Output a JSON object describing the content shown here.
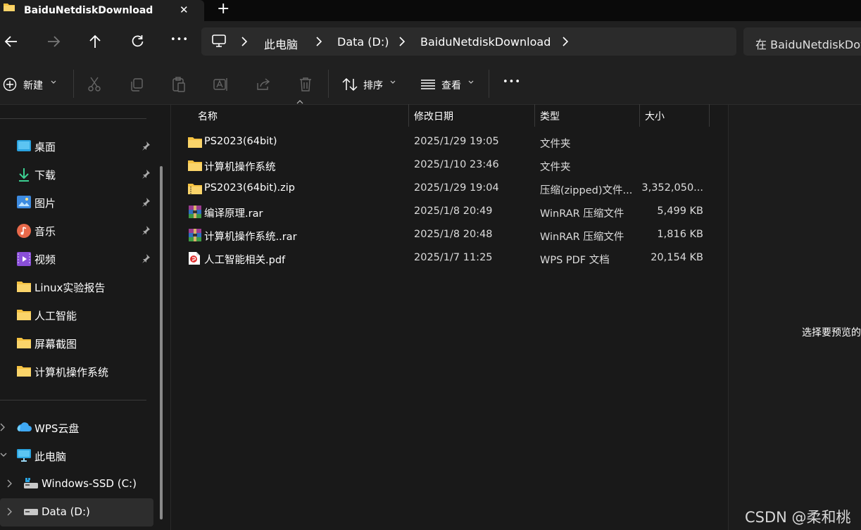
{
  "window": {
    "tab_title": "BaiduNetdiskDownload",
    "close_glyph": "✕",
    "new_tab_glyph": "+"
  },
  "nav": {
    "back_icon": "arrow-left-icon",
    "forward_icon": "arrow-right-icon",
    "up_icon": "arrow-up-icon",
    "refresh_icon": "refresh-icon",
    "more_glyph": "•••"
  },
  "breadcrumb": [
    "此电脑",
    "Data (D:)",
    "BaiduNetdiskDownload"
  ],
  "search": {
    "placeholder": "在 BaiduNetdiskDow"
  },
  "toolbar": {
    "new_label": "新建",
    "sort_label": "排序",
    "view_label": "查看",
    "more_glyph": "•••"
  },
  "sidebar": {
    "quick_access": [
      {
        "label": "桌面",
        "icon": "desktop-icon",
        "pinned": true
      },
      {
        "label": "下载",
        "icon": "download-icon",
        "pinned": true
      },
      {
        "label": "图片",
        "icon": "pictures-icon",
        "pinned": true
      },
      {
        "label": "音乐",
        "icon": "music-icon",
        "pinned": true
      },
      {
        "label": "视频",
        "icon": "video-icon",
        "pinned": true
      },
      {
        "label": "Linux实验报告",
        "icon": "folder-icon",
        "pinned": false
      },
      {
        "label": "人工智能",
        "icon": "folder-icon",
        "pinned": false
      },
      {
        "label": "屏幕截图",
        "icon": "folder-icon",
        "pinned": false
      },
      {
        "label": "计算机操作系统",
        "icon": "folder-icon",
        "pinned": false
      }
    ],
    "locations": [
      {
        "label": "WPS云盘",
        "icon": "cloud-icon",
        "expanded": false
      },
      {
        "label": "此电脑",
        "icon": "pc-icon",
        "expanded": true
      },
      {
        "label": "Windows-SSD (C:)",
        "icon": "drive-icon",
        "expanded": false
      },
      {
        "label": "Data (D:)",
        "icon": "drive-icon",
        "expanded": false,
        "selected": true
      }
    ]
  },
  "list": {
    "columns": [
      "名称",
      "修改日期",
      "类型",
      "大小"
    ],
    "rows": [
      {
        "name": "PS2023(64bit)",
        "date": "2025/1/29 19:05",
        "type": "文件夹",
        "size": "",
        "icon": "folder-icon"
      },
      {
        "name": "计算机操作系统",
        "date": "2025/1/10 23:46",
        "type": "文件夹",
        "size": "",
        "icon": "folder-icon"
      },
      {
        "name": "PS2023(64bit).zip",
        "date": "2025/1/29 19:04",
        "type": "压缩(zipped)文件...",
        "size": "3,352,050...",
        "icon": "zip-folder-icon"
      },
      {
        "name": "编译原理.rar",
        "date": "2025/1/8 20:49",
        "type": "WinRAR 压缩文件",
        "size": "5,499 KB",
        "icon": "winrar-icon"
      },
      {
        "name": "计算机操作系统..rar",
        "date": "2025/1/8 20:48",
        "type": "WinRAR 压缩文件",
        "size": "1,816 KB",
        "icon": "winrar-icon"
      },
      {
        "name": "人工智能相关.pdf",
        "date": "2025/1/7 11:25",
        "type": "WPS PDF 文档",
        "size": "20,154 KB",
        "icon": "pdf-icon"
      }
    ]
  },
  "preview": {
    "text": "选择要预览的"
  },
  "watermark": "CSDN @柔和桃",
  "colors": {
    "folder": "#f5c242",
    "background": "#191919",
    "panel": "#202020"
  }
}
